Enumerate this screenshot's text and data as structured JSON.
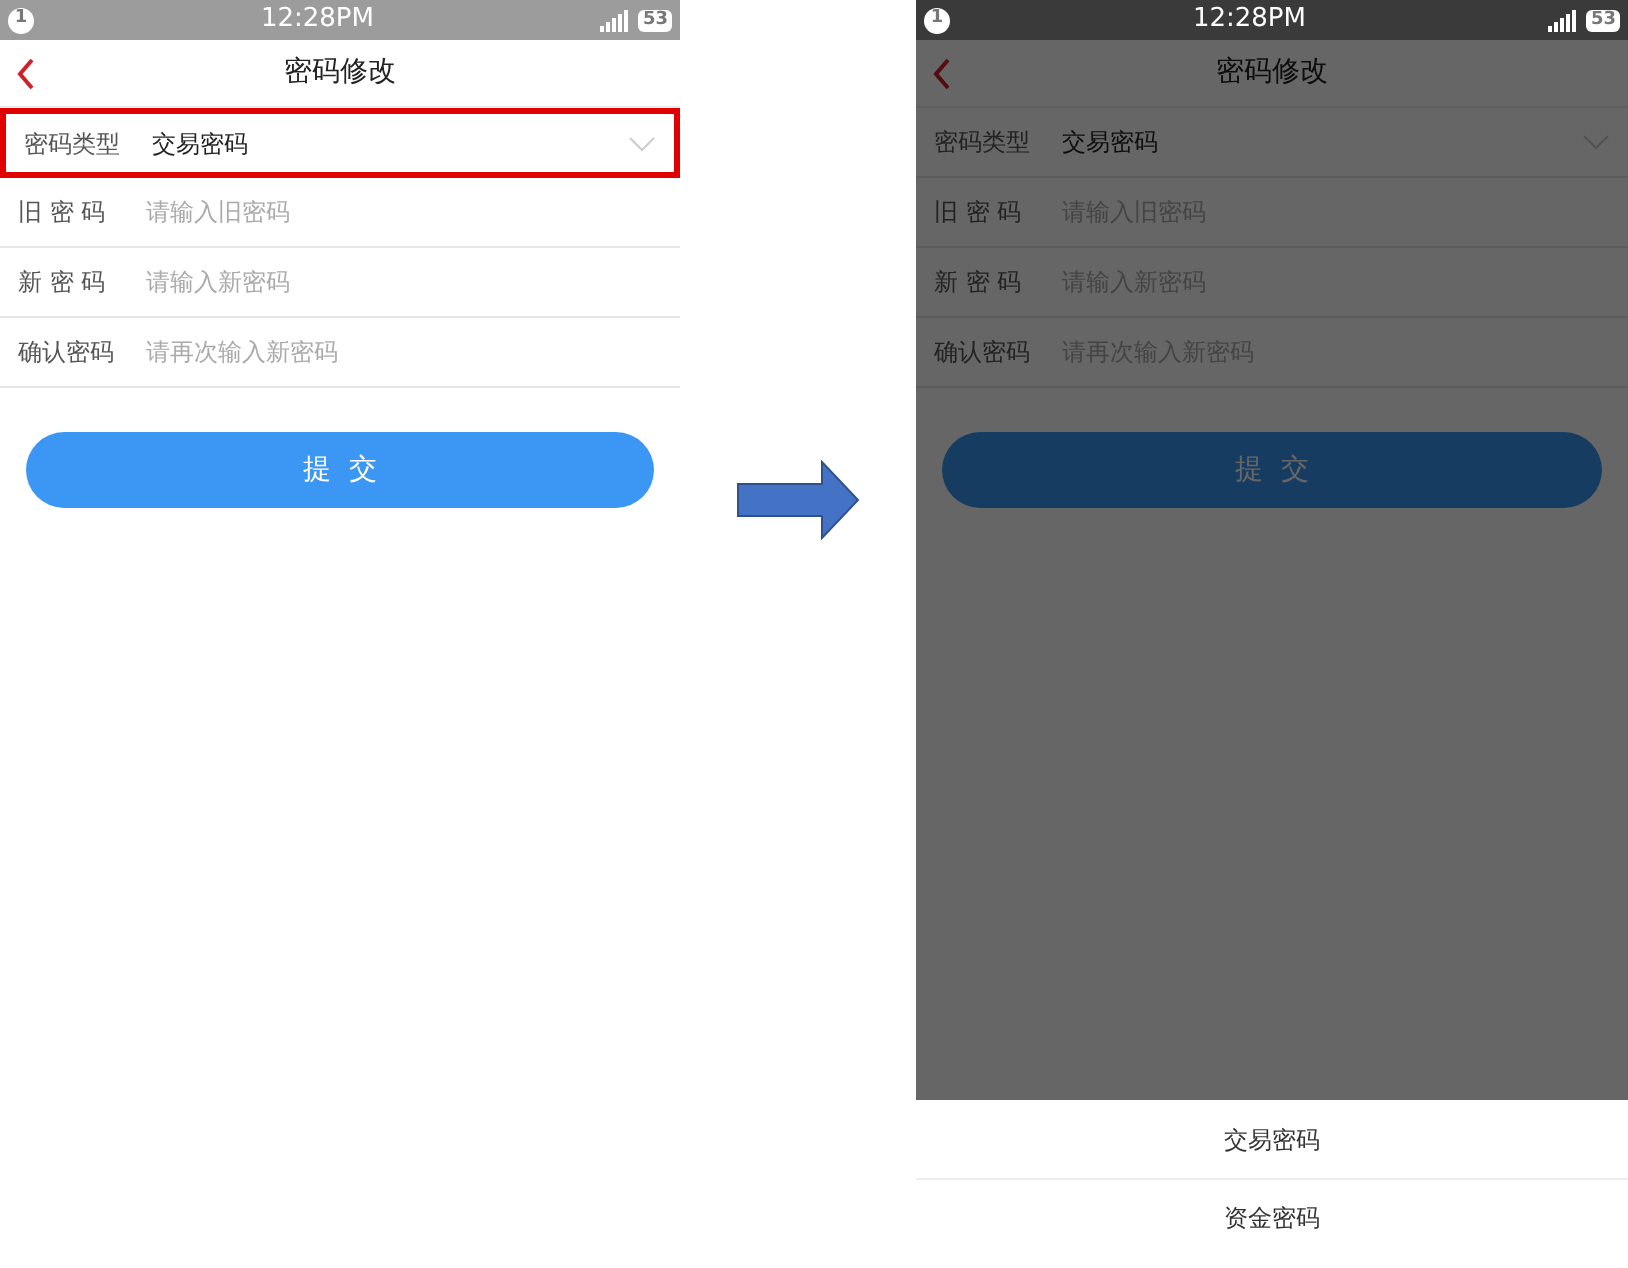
{
  "screens": [
    {
      "status_bar": {
        "notification": "1",
        "time": "12:28PM",
        "battery": "53"
      },
      "title": "密码修改",
      "dimmed": false,
      "fields": [
        {
          "kind": "select",
          "label": "密码类型",
          "value": "交易密码",
          "highlighted": true
        },
        {
          "kind": "input",
          "label": "旧 密 码",
          "placeholder": "请输入旧密码",
          "highlighted": false
        },
        {
          "kind": "input",
          "label": "新 密 码",
          "placeholder": "请输入新密码",
          "highlighted": false
        },
        {
          "kind": "input",
          "label": "确认密码",
          "placeholder": "请再次输入新密码",
          "highlighted": false
        }
      ],
      "submit": "提  交"
    },
    {
      "status_bar": {
        "notification": "1",
        "time": "12:28PM",
        "battery": "53"
      },
      "title": "密码修改",
      "dimmed": true,
      "fields": [
        {
          "kind": "select",
          "label": "密码类型",
          "value": "交易密码",
          "highlighted": false
        },
        {
          "kind": "input",
          "label": "旧 密 码",
          "placeholder": "请输入旧密码",
          "highlighted": false
        },
        {
          "kind": "input",
          "label": "新 密 码",
          "placeholder": "请输入新密码",
          "highlighted": false
        },
        {
          "kind": "input",
          "label": "确认密码",
          "placeholder": "请再次输入新密码",
          "highlighted": false
        }
      ],
      "submit": "提  交",
      "picker": [
        {
          "label": "交易密码"
        },
        {
          "label": "资金密码"
        }
      ]
    }
  ]
}
